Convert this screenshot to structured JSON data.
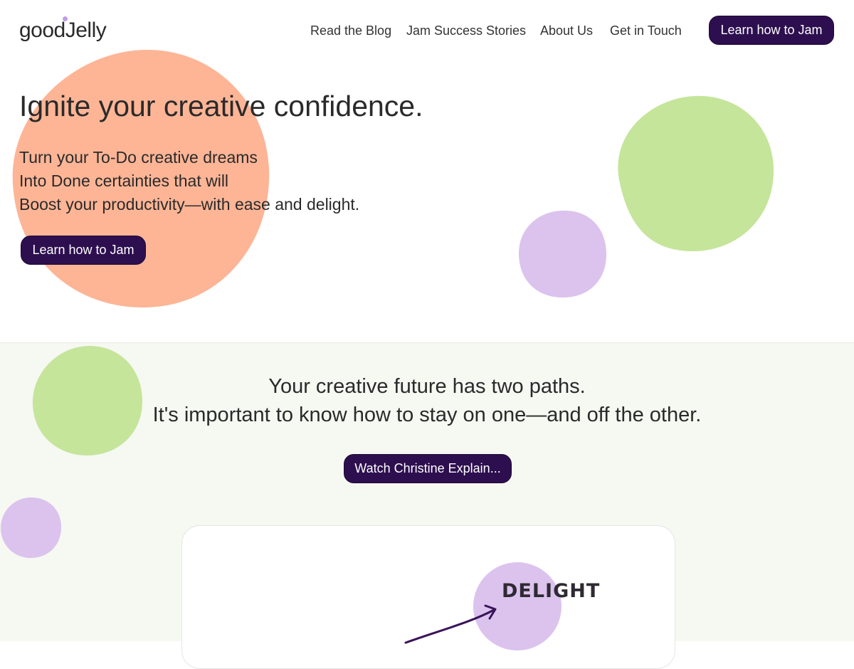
{
  "header": {
    "logo_text": "goodJelly",
    "nav": [
      "Read the Blog",
      "Jam Success Stories",
      "About Us",
      "Get in Touch"
    ],
    "cta_label": "Learn how to Jam"
  },
  "hero": {
    "title": "Ignite your creative confidence.",
    "lines": [
      "Turn your To-Do creative dreams",
      "Into Done certainties that will",
      "Boost your productivity—with ease and delight."
    ],
    "cta_label": "Learn how to Jam"
  },
  "paths": {
    "line1": "Your creative future has two paths.",
    "line2": "It's important to know how to stay on one—and off the other.",
    "cta_label": "Watch Christine Explain..."
  },
  "diagram": {
    "delight_label": "DELIGHT"
  },
  "colors": {
    "accent_dark_purple": "#2d0f4f",
    "peach": "#fdb596",
    "green": "#c5e59a",
    "lavender": "#dbc3ee",
    "section_bg": "#f6f8f2"
  }
}
